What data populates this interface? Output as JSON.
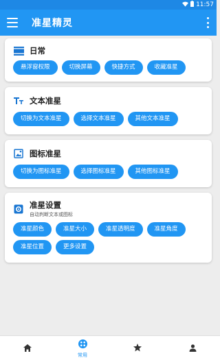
{
  "status_bar": {
    "time": "11:57"
  },
  "app_bar": {
    "title": "准星精灵"
  },
  "cards": [
    {
      "title": "日常",
      "subtitle": "",
      "icon": "monitor-icon",
      "buttons": [
        "悬浮窗权限",
        "切换屏幕",
        "快捷方式",
        "收藏准星"
      ]
    },
    {
      "title": "文本准星",
      "subtitle": "",
      "icon": "text-format-icon",
      "buttons": [
        "切换为文本准星",
        "选择文本准星",
        "其他文本准星"
      ]
    },
    {
      "title": "图标准星",
      "subtitle": "",
      "icon": "image-icon",
      "buttons": [
        "切换为图标准星",
        "选择图标准星",
        "其他图标准星"
      ]
    },
    {
      "title": "准星设置",
      "subtitle": "自动判断文本或图标",
      "icon": "settings-icon",
      "buttons": [
        "准星颜色",
        "准星大小",
        "准星透明度",
        "准星角度",
        "准星位置",
        "更多设置"
      ]
    }
  ],
  "bottom_nav": [
    {
      "label": "",
      "icon": "home-icon"
    },
    {
      "label": "常用",
      "icon": "apps-icon",
      "active": true
    },
    {
      "label": "",
      "icon": "star-icon"
    },
    {
      "label": "",
      "icon": "person-icon"
    }
  ],
  "colors": {
    "primary": "#2196f3",
    "primary_dark": "#1e88e5"
  }
}
